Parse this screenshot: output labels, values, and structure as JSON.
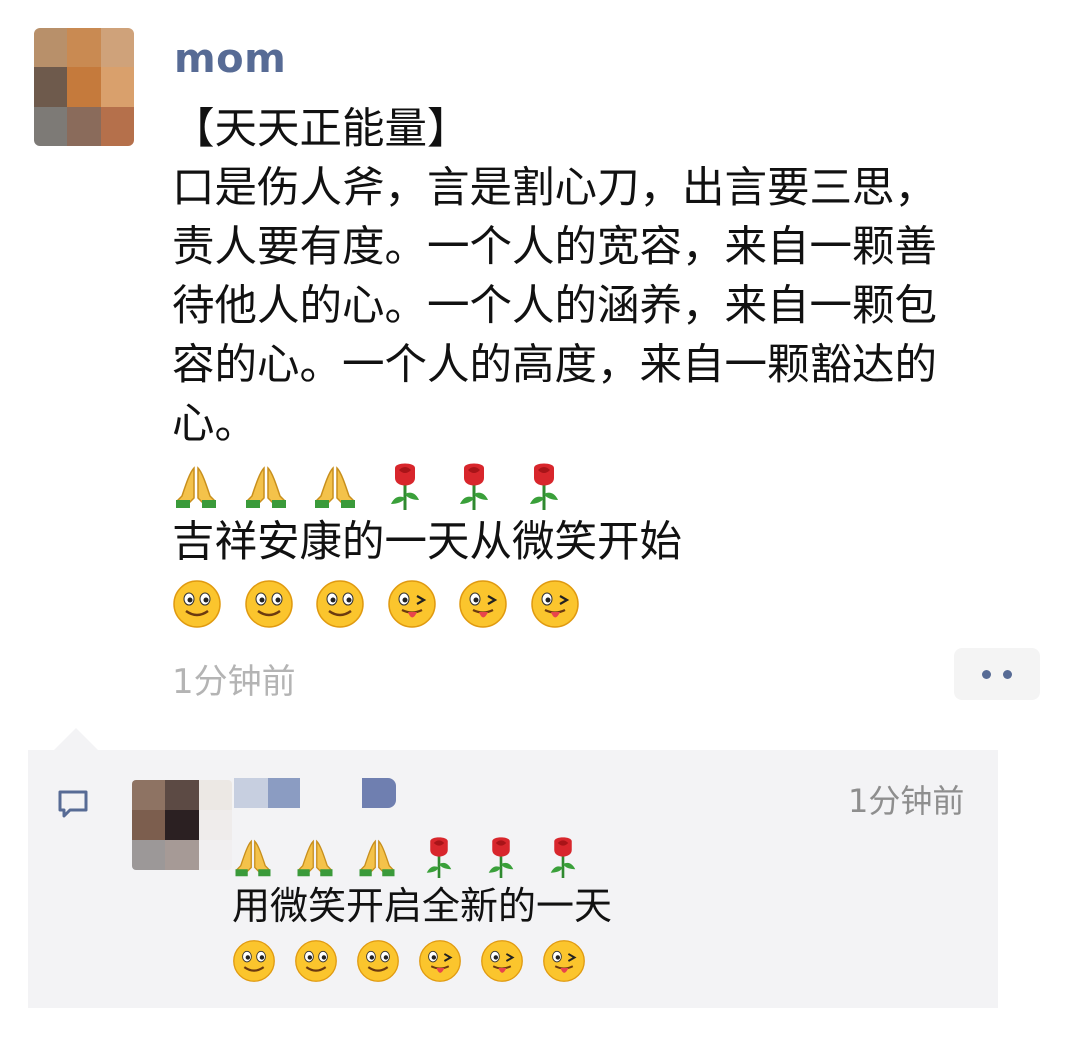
{
  "post": {
    "author": "mom",
    "lines": [
      "【天天正能量】",
      "口是伤人斧，言是割心刀，出言要三思，",
      "责人要有度。一个人的宽容，来自一颗善",
      "待他人的心。一个人的涵养，来自一颗包",
      "容的心。一个人的高度，来自一颗豁达的",
      "心。"
    ],
    "closing_line": "吉祥安康的一天从微笑开始",
    "time": "1分钟前",
    "emoji_row_1": [
      "pray-icon",
      "pray-icon",
      "pray-icon",
      "rose-icon",
      "rose-icon",
      "rose-icon"
    ],
    "emoji_row_2": [
      "smile-icon",
      "smile-icon",
      "smile-icon",
      "wink-tongue-icon",
      "wink-tongue-icon",
      "wink-tongue-icon"
    ]
  },
  "comment": {
    "time": "1分钟前",
    "text": "用微笑开启全新的一天",
    "emoji_row_1": [
      "pray-icon",
      "pray-icon",
      "pray-icon",
      "rose-icon",
      "rose-icon",
      "rose-icon"
    ],
    "emoji_row_2": [
      "smile-icon",
      "smile-icon",
      "smile-icon",
      "wink-tongue-icon",
      "wink-tongue-icon",
      "wink-tongue-icon"
    ]
  },
  "colors": {
    "name_link": "#576b95",
    "timestamp": "#b4b4b4",
    "comment_bg": "#f3f3f5"
  }
}
